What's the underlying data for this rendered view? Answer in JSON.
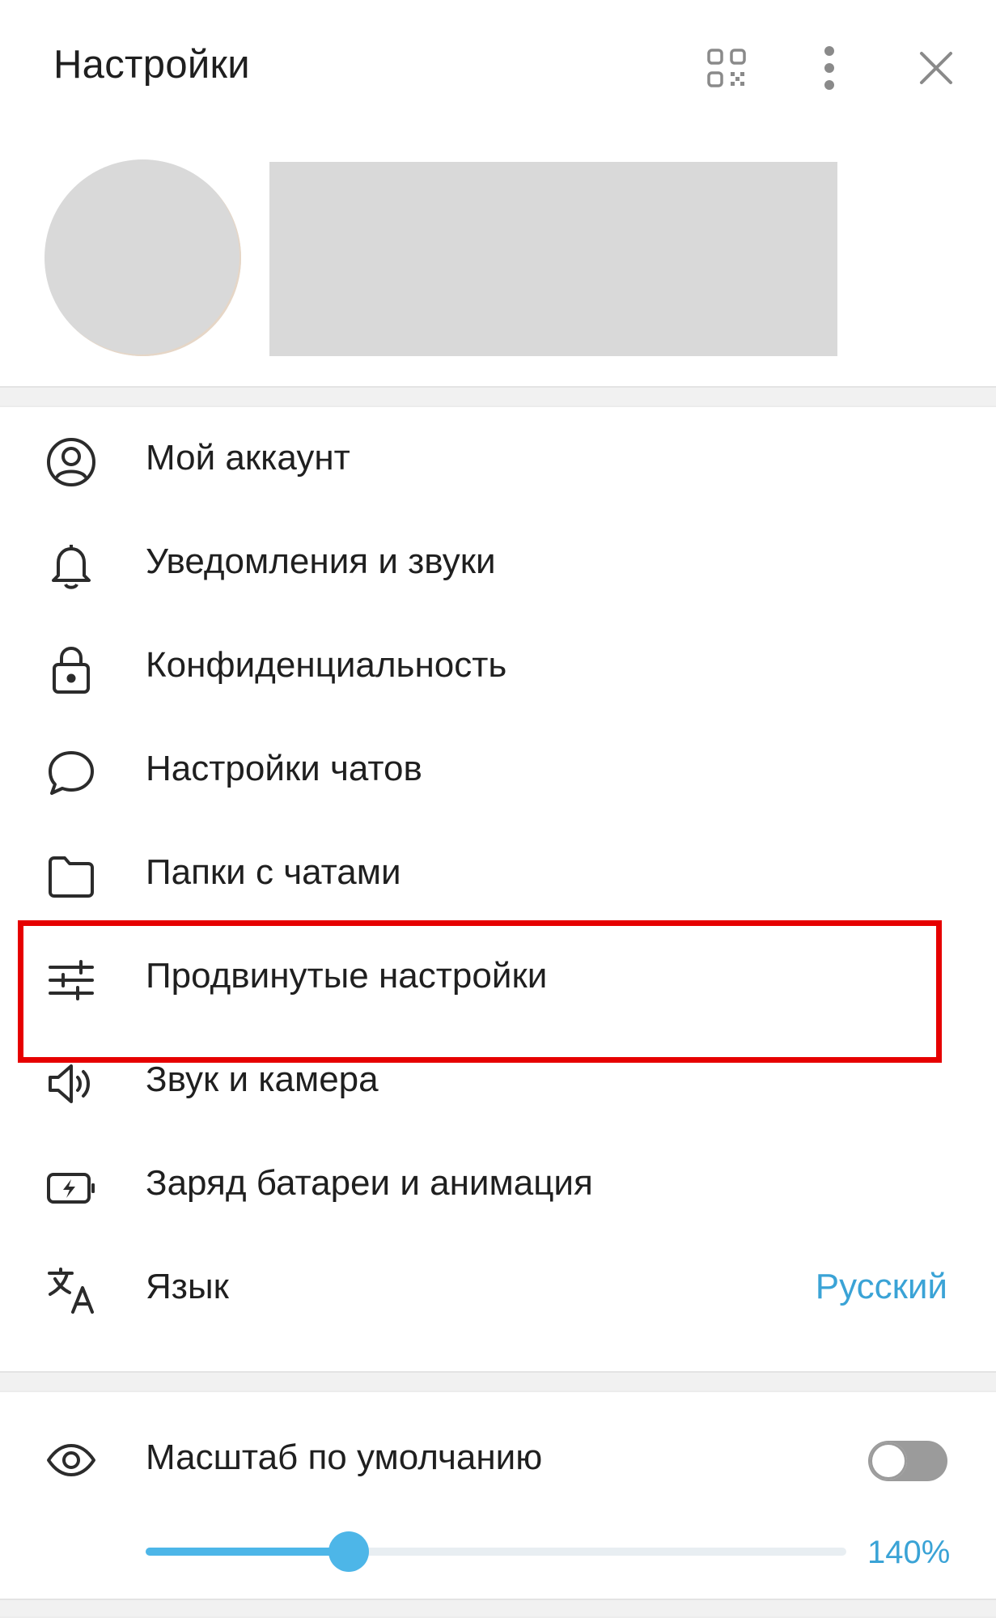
{
  "header": {
    "title": "Настройки",
    "icons": [
      "qr-code-icon",
      "more-vertical-icon",
      "close-icon"
    ]
  },
  "colors": {
    "accent": "#3aa3d6",
    "slider": "#4db6e8",
    "highlight": "#e60000",
    "icon": "#2b2b2b"
  },
  "menu": {
    "items": [
      {
        "label": "Мой аккаунт",
        "icon": "account-icon"
      },
      {
        "label": "Уведомления и звуки",
        "icon": "bell-icon"
      },
      {
        "label": "Конфиденциальность",
        "icon": "lock-icon"
      },
      {
        "label": "Настройки чатов",
        "icon": "chat-bubble-icon"
      },
      {
        "label": "Папки с чатами",
        "icon": "folder-icon"
      },
      {
        "label": "Продвинутые настройки",
        "icon": "sliders-icon"
      },
      {
        "label": "Звук и камера",
        "icon": "speaker-icon"
      },
      {
        "label": "Заряд батареи и анимация",
        "icon": "battery-charge-icon"
      },
      {
        "label": "Язык",
        "icon": "translate-icon",
        "value": "Русский"
      }
    ]
  },
  "zoom": {
    "label": "Масштаб по умолчанию",
    "icon": "eye-icon",
    "toggle_on": false,
    "value_label": "140%",
    "slider_fraction": 0.29
  }
}
